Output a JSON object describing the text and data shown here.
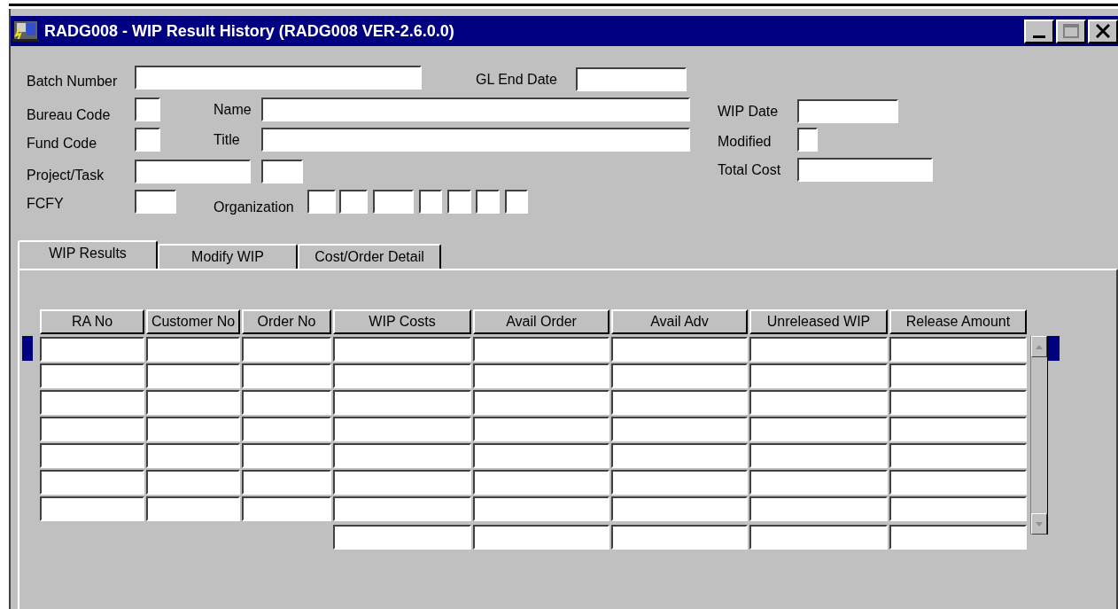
{
  "window": {
    "title": "RADG008 - WIP Result History (RADG008 VER-2.6.0.0)"
  },
  "header_fields": [
    {
      "label": "Batch Number"
    },
    {
      "label": "GL End Date"
    },
    {
      "label": "Bureau Code"
    },
    {
      "label": "Name"
    },
    {
      "label": "WIP Date"
    },
    {
      "label": "Fund Code"
    },
    {
      "label": "Title"
    },
    {
      "label": "Modified"
    },
    {
      "label": "Project/Task"
    },
    {
      "label": "Total Cost"
    },
    {
      "label": "FCFY"
    },
    {
      "label": "Organization"
    }
  ],
  "tabs": [
    {
      "label": "WIP Results",
      "selected": true
    },
    {
      "label": "Modify WIP",
      "selected": false
    },
    {
      "label": "Cost/Order Detail",
      "selected": false
    }
  ],
  "table": {
    "columns": [
      "RA No",
      "Customer No",
      "Order No",
      "WIP Costs",
      "Avail Order",
      "Avail Adv",
      "Unreleased WIP",
      "Release Amount"
    ],
    "rows": [
      {
        "current": true
      },
      {
        "current": false
      },
      {
        "current": false
      },
      {
        "current": false
      },
      {
        "current": false
      },
      {
        "current": false
      },
      {
        "current": false
      }
    ]
  }
}
